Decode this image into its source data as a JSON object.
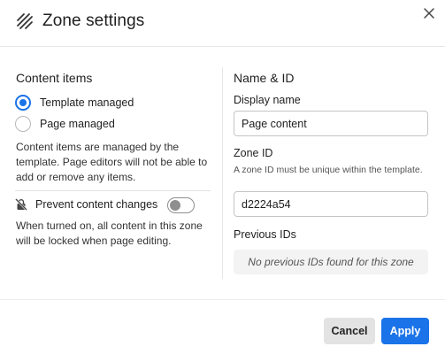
{
  "dialog": {
    "title": "Zone settings",
    "icons": {
      "header": "zone-hatch-icon",
      "close": "close-icon",
      "lock": "lock-slash-icon"
    }
  },
  "content_items": {
    "heading": "Content items",
    "options": [
      {
        "label": "Template managed",
        "selected": true
      },
      {
        "label": "Page managed",
        "selected": false
      }
    ],
    "description": "Content items are managed by the template. Page editors will not be able to add or remove any items.",
    "prevent_changes": {
      "label": "Prevent content changes",
      "enabled": false,
      "description": "When turned on, all content in this zone will be locked when page editing."
    }
  },
  "name_id": {
    "heading": "Name & ID",
    "display_name": {
      "label": "Display name",
      "value": "Page content"
    },
    "zone_id": {
      "label": "Zone ID",
      "help": "A zone ID must be unique within the template.",
      "value": "d2224a54"
    },
    "previous_ids": {
      "label": "Previous IDs",
      "empty_text": "No previous IDs found for this zone"
    }
  },
  "footer": {
    "cancel_label": "Cancel",
    "apply_label": "Apply"
  },
  "colors": {
    "accent": "#1a73e8",
    "cancel_bg": "#e3e3e3"
  }
}
